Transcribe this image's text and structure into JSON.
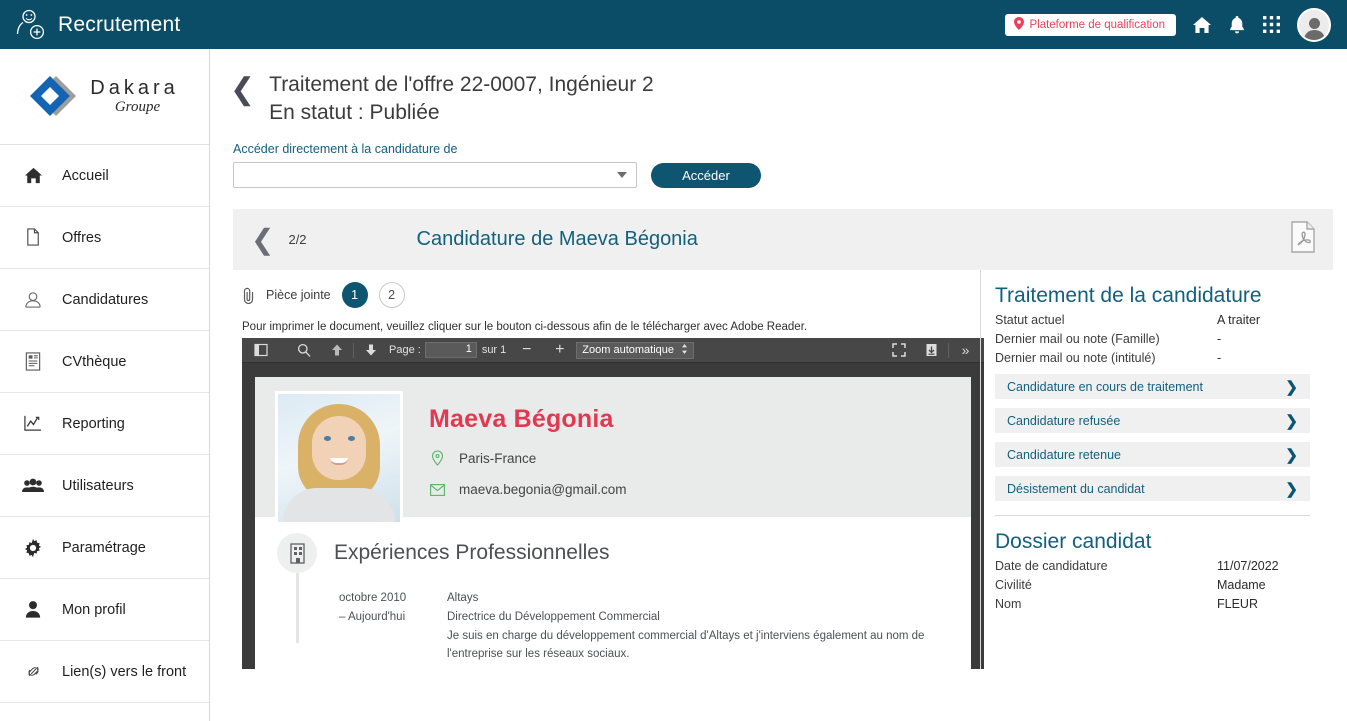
{
  "header": {
    "app_title": "Recrutement",
    "logo_icon": "user-plus-icon",
    "qualification_badge": {
      "label": "Plateforme de qualification",
      "icon": "location-pin-icon",
      "color": "#e8425a"
    },
    "icons": [
      {
        "name": "home-icon",
        "glyph": "home"
      },
      {
        "name": "notification-bell-icon",
        "glyph": "bell"
      },
      {
        "name": "apps-grid-icon",
        "glyph": "grid"
      }
    ],
    "avatar_name": "user-avatar",
    "background_color": "#0b4d66"
  },
  "sidebar": {
    "logo": {
      "primary": "Dakara",
      "secondary": "Groupe"
    },
    "items": [
      {
        "label": "Accueil",
        "icon": "home-icon"
      },
      {
        "label": "Offres",
        "icon": "documents-icon"
      },
      {
        "label": "Candidatures",
        "icon": "user-card-icon"
      },
      {
        "label": "CVthèque",
        "icon": "cv-document-icon"
      },
      {
        "label": "Reporting",
        "icon": "chart-line-icon"
      },
      {
        "label": "Utilisateurs",
        "icon": "users-group-icon"
      },
      {
        "label": "Paramétrage",
        "icon": "gear-icon"
      },
      {
        "label": "Mon profil",
        "icon": "person-icon"
      },
      {
        "label": "Lien(s) vers le front",
        "icon": "link-icon"
      }
    ]
  },
  "page": {
    "back_icon": "chevron-left-icon",
    "title_line1": "Traitement de l'offre 22-0007, Ingénieur 2",
    "title_line2": "En statut : Publiée",
    "access": {
      "label": "Accéder directement à la candidature de",
      "select_value": "",
      "select_placeholder": "",
      "button_label": "Accéder"
    }
  },
  "candidature_banner": {
    "back_icon": "chevron-left-icon",
    "counter": "2/2",
    "title_prefix": "Candidature de",
    "candidate_name": "Maeva Bégonia",
    "pdf_icon": "pdf-file-icon"
  },
  "attachments": {
    "icon": "paperclip-icon",
    "label": "Pièce jointe",
    "tabs": [
      {
        "label": "1",
        "active": true
      },
      {
        "label": "2",
        "active": false
      }
    ]
  },
  "pdf": {
    "print_note": "Pour imprimer le document, veuillez cliquer sur le bouton ci-dessous afin de le télécharger avec Adobe Reader.",
    "toolbar": {
      "sidebar_toggle_icon": "sidebar-toggle-icon",
      "search_icon": "search-icon",
      "prev_page_icon": "arrow-up-icon",
      "next_page_icon": "arrow-down-icon",
      "page_label": "Page :",
      "page_value": "1",
      "page_of": "sur 1",
      "zoom_out_icon": "minus-icon",
      "zoom_in_icon": "plus-icon",
      "zoom_value": "Zoom automatique",
      "presentation_icon": "fullscreen-icon",
      "download_icon": "download-icon",
      "tools_icon": "double-chevron-right-icon"
    },
    "cv": {
      "name": "Maeva Bégonia",
      "name_color": "#e03a52",
      "location": "Paris-France",
      "location_icon": "map-pin-icon",
      "email": "maeva.begonia@gmail.com",
      "email_icon": "envelope-icon",
      "section_title": "Expériences Professionnelles",
      "section_icon": "building-icon",
      "experiences": [
        {
          "date_from": "octobre 2010",
          "date_to": "– Aujourd'hui",
          "company": "Altays",
          "role": "Directrice du Développement Commercial",
          "description": "Je suis en charge du développement commercial d'Altays et j'interviens également au nom de l'entreprise sur les réseaux sociaux."
        }
      ]
    }
  },
  "right_panel": {
    "treatment": {
      "title": "Traitement de la candidature",
      "fields": [
        {
          "key": "Statut actuel",
          "value": "A traiter"
        },
        {
          "key": "Dernier mail ou note (Famille)",
          "value": "-"
        },
        {
          "key": "Dernier mail ou note (intitulé)",
          "value": "-"
        }
      ],
      "actions": [
        {
          "label": "Candidature en cours de traitement",
          "icon": "chevron-right-icon"
        },
        {
          "label": "Candidature refusée",
          "icon": "chevron-right-icon"
        },
        {
          "label": "Candidature retenue",
          "icon": "chevron-right-icon"
        },
        {
          "label": "Désistement du candidat",
          "icon": "chevron-right-icon"
        }
      ]
    },
    "dossier": {
      "title": "Dossier candidat",
      "fields": [
        {
          "key": "Date de candidature",
          "value": "11/07/2022"
        },
        {
          "key": "Civilité",
          "value": "Madame"
        },
        {
          "key": "Nom",
          "value": "FLEUR"
        }
      ]
    }
  }
}
